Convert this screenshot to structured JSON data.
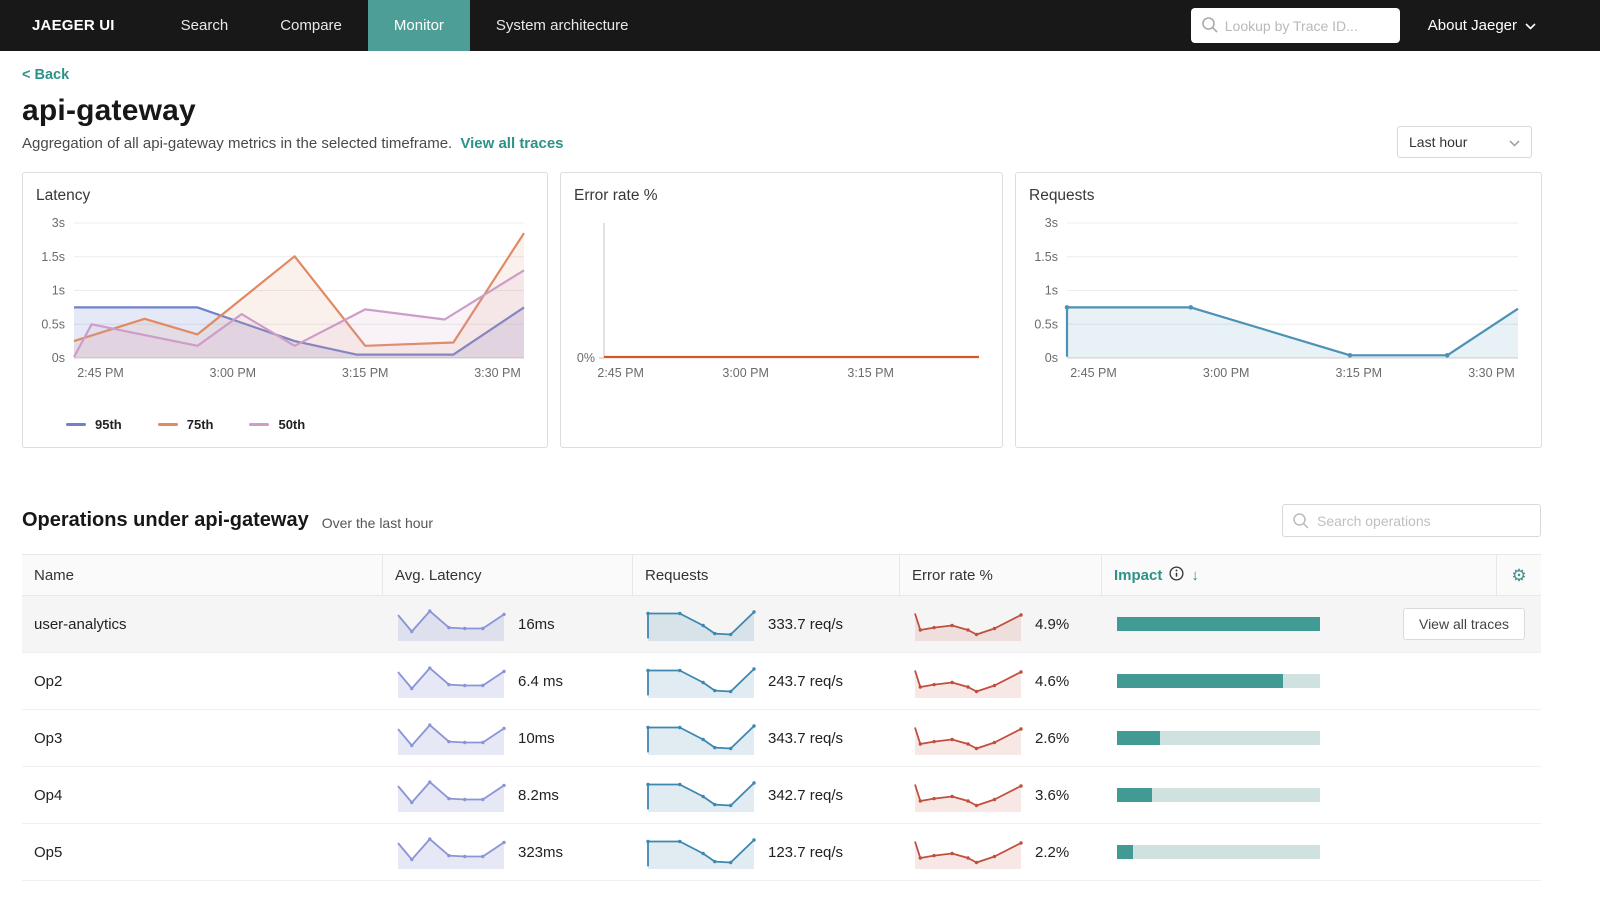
{
  "colors": {
    "accent": "#2d9287",
    "nav_active_bg": "#4e9e98",
    "impact_fill": "#429a94",
    "impact_track": "#cfe2e0"
  },
  "nav": {
    "brand": "JAEGER UI",
    "items": [
      {
        "label": "Search",
        "active": false
      },
      {
        "label": "Compare",
        "active": false
      },
      {
        "label": "Monitor",
        "active": true
      },
      {
        "label": "System architecture",
        "active": false
      }
    ],
    "trace_search_placeholder": "Lookup by Trace ID...",
    "about": "About Jaeger"
  },
  "header": {
    "back": "< Back",
    "title": "api-gateway",
    "subtitle": "Aggregation of all api-gateway metrics in the selected timeframe.",
    "view_all_traces": "View all traces",
    "timeframe": "Last hour"
  },
  "chart_data": [
    {
      "type": "line",
      "title": "Latency",
      "y_ticks": [
        "0s",
        "0.5s",
        "1s",
        "1.5s",
        "3s"
      ],
      "y_scale_values": [
        0,
        0.5,
        1,
        1.5,
        3
      ],
      "x_ticks": [
        "2:45 PM",
        "3:00 PM",
        "3:15 PM",
        "3:30 PM"
      ],
      "x_tick_min": [
        5,
        20,
        35,
        50
      ],
      "x_domain_min": [
        2,
        53
      ],
      "legend_position": "bottom",
      "grid": true,
      "series": [
        {
          "name": "95th",
          "color": "#7082cc",
          "fill": "rgba(112,130,204,0.18)",
          "points": [
            [
              2,
              0.75
            ],
            [
              16,
              0.75
            ],
            [
              27,
              0.25
            ],
            [
              34,
              0.05
            ],
            [
              45,
              0.05
            ],
            [
              53,
              0.75
            ]
          ]
        },
        {
          "name": "75th",
          "color": "#e08a64",
          "fill": "rgba(224,138,100,0.12)",
          "points": [
            [
              2,
              0.25
            ],
            [
              10,
              0.58
            ],
            [
              16,
              0.35
            ],
            [
              27,
              1.52
            ],
            [
              35,
              0.18
            ],
            [
              45,
              0.23
            ],
            [
              53,
              2.55
            ]
          ]
        },
        {
          "name": "50th",
          "color": "#ce9cc9",
          "fill": "rgba(206,156,201,0.12)",
          "points": [
            [
              2,
              0.0
            ],
            [
              4,
              0.5
            ],
            [
              16,
              0.18
            ],
            [
              21,
              0.65
            ],
            [
              27,
              0.18
            ],
            [
              35,
              0.72
            ],
            [
              44,
              0.57
            ],
            [
              53,
              1.3
            ]
          ]
        }
      ]
    },
    {
      "type": "line",
      "title": "Error rate %",
      "y_ticks": [
        "0%"
      ],
      "y_scale_values": [
        0
      ],
      "x_ticks": [
        "2:45 PM",
        "3:00 PM",
        "3:15 PM"
      ],
      "x_tick_min": [
        5,
        20,
        35
      ],
      "x_domain_min": [
        3,
        48
      ],
      "grid": false,
      "y_axis_line": true,
      "series": [
        {
          "name": "error rate",
          "color": "#d9532f",
          "fill": "none",
          "points": [
            [
              3,
              0
            ],
            [
              48,
              0
            ]
          ]
        }
      ]
    },
    {
      "type": "area",
      "title": "Requests",
      "y_ticks": [
        "0s",
        "0.5s",
        "1s",
        "1.5s",
        "3s"
      ],
      "y_scale_values": [
        0,
        0.5,
        1,
        1.5,
        3
      ],
      "x_ticks": [
        "2:45 PM",
        "3:00 PM",
        "3:15 PM",
        "3:30 PM"
      ],
      "x_tick_min": [
        5,
        20,
        35,
        50
      ],
      "x_domain_min": [
        2,
        53
      ],
      "grid": true,
      "series": [
        {
          "name": "requests",
          "color": "#4b92b4",
          "fill": "rgba(75,146,180,0.13)",
          "dots": true,
          "points": [
            [
              2,
              0.02
            ],
            [
              2,
              0.75
            ],
            [
              16,
              0.75
            ],
            [
              34,
              0.04
            ],
            [
              45,
              0.04
            ],
            [
              53,
              0.73
            ]
          ]
        }
      ]
    }
  ],
  "sparks": {
    "latency": {
      "color": "#8b95d6",
      "fill": "rgba(139,149,214,0.22)",
      "points": [
        [
          0,
          0.8
        ],
        [
          0.13,
          0.25
        ],
        [
          0.3,
          0.93
        ],
        [
          0.48,
          0.38
        ],
        [
          0.63,
          0.35
        ],
        [
          0.8,
          0.35
        ],
        [
          1,
          0.82
        ]
      ]
    },
    "requests": {
      "color": "#3d87b0",
      "fill": "rgba(61,135,176,0.16)",
      "points": [
        [
          0,
          0.02
        ],
        [
          0,
          0.85
        ],
        [
          0.3,
          0.85
        ],
        [
          0.52,
          0.45
        ],
        [
          0.63,
          0.18
        ],
        [
          0.78,
          0.15
        ],
        [
          1,
          0.9
        ]
      ]
    },
    "error": {
      "color": "#c14f3e",
      "fill": "rgba(193,79,62,0.13)",
      "points": [
        [
          0,
          0.85
        ],
        [
          0.05,
          0.3
        ],
        [
          0.18,
          0.38
        ],
        [
          0.35,
          0.45
        ],
        [
          0.5,
          0.3
        ],
        [
          0.58,
          0.15
        ],
        [
          0.75,
          0.35
        ],
        [
          1,
          0.8
        ]
      ]
    }
  },
  "operations": {
    "title": "Operations under api-gateway",
    "subtitle": "Over the last hour",
    "search_placeholder": "Search operations",
    "columns": [
      "Name",
      "Avg. Latency",
      "Requests",
      "Error rate %",
      "Impact"
    ],
    "rows": [
      {
        "name": "user-analytics",
        "latency": "16ms",
        "requests": "333.7 req/s",
        "error": "4.9%",
        "impact": 1.0,
        "action": "View all traces",
        "highlight": true
      },
      {
        "name": "Op2",
        "latency": "6.4 ms",
        "requests": "243.7 req/s",
        "error": "4.6%",
        "impact": 0.82
      },
      {
        "name": "Op3",
        "latency": "10ms",
        "requests": "343.7 req/s",
        "error": "2.6%",
        "impact": 0.21
      },
      {
        "name": "Op4",
        "latency": "8.2ms",
        "requests": "342.7 req/s",
        "error": "3.6%",
        "impact": 0.17
      },
      {
        "name": "Op5",
        "latency": "323ms",
        "requests": "123.7 req/s",
        "error": "2.2%",
        "impact": 0.08
      }
    ]
  }
}
